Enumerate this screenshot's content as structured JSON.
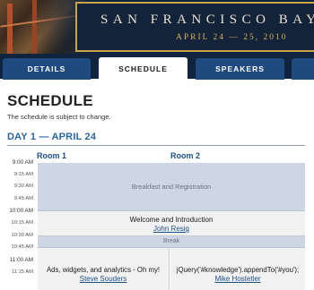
{
  "banner": {
    "title": "SAN FRANCISCO BAY",
    "date": "APRIL 24 — 25, 2010"
  },
  "tabs": [
    {
      "label": "DETAILS",
      "active": false
    },
    {
      "label": "SCHEDULE",
      "active": true
    },
    {
      "label": "SPEAKERS",
      "active": false
    }
  ],
  "page": {
    "title": "SCHEDULE",
    "subtitle": "The schedule is subject to change."
  },
  "day": {
    "heading": "DAY 1 — APRIL 24",
    "rooms": [
      "Room 1",
      "Room 2"
    ],
    "times": [
      "9:00 AM",
      "9:15 AM",
      "9:30 AM",
      "9:45 AM",
      "10:00 AM",
      "10:15 AM",
      "10:30 AM",
      "10:45 AM",
      "11:00 AM",
      "11:15 AM"
    ],
    "sessions": {
      "breakfast": {
        "title": "Breakfast and Registration"
      },
      "welcome": {
        "title": "Welcome and Introduction",
        "speaker": "John Resig"
      },
      "break": {
        "title": "Break"
      },
      "ads": {
        "title": "Ads, widgets, and analytics - Oh my!",
        "speaker": "Steve Souders"
      },
      "jquery": {
        "title": "jQuery('#knowledge').appendTo('#you');",
        "speaker": "Mike Hostetler"
      }
    }
  },
  "colors": {
    "nav_bg": "#10243d",
    "tab_bg": "#1f4a7f",
    "accent_gold": "#d9b15a",
    "day_heading": "#2a66a3",
    "break_bg": "#cdd6e2"
  }
}
